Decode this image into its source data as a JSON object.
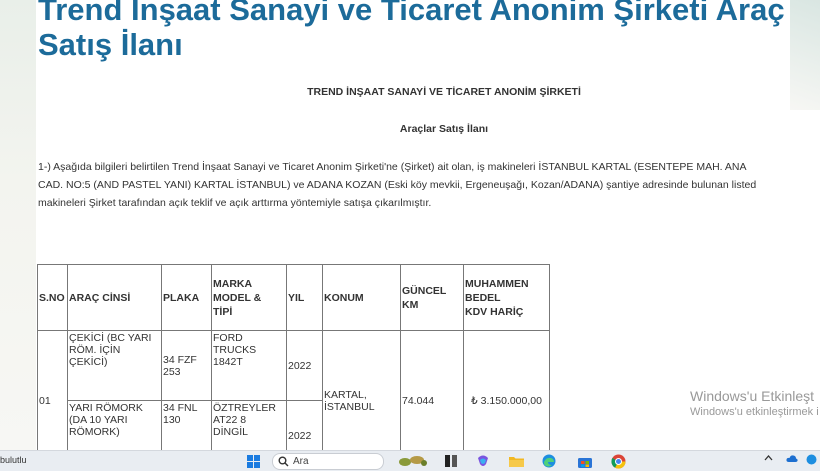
{
  "page": {
    "title_line1": "Trend İnşaat Sanayi ve Ticaret Anonim Şirketi Araç",
    "title_line2": "Satış İlanı",
    "company_heading": "TREND İNŞAAT SANAYİ VE TİCARET ANONİM ŞİRKETİ",
    "sub_heading": "Araçlar Satış İlanı",
    "paragraph_lines": [
      "1-) Aşağıda bilgileri belirtilen Trend İnşaat Sanayi ve Ticaret Anonim Şirketi'ne (Şirket) ait olan, iş makineleri İSTANBUL KARTAL (ESENTEPE MAH. ANA",
      "CAD. NO:5 (AND PASTEL YANI) KARTAL İSTANBUL) ve ADANA KOZAN (Eski köy mevkii, Ergeneuşağı, Kozan/ADANA) şantiye adresinde bulunan listed",
      "makineleri Şirket tarafından açık teklif ve açık arttırma yöntemiyle satışa çıkarılmıştır."
    ]
  },
  "table": {
    "headers": {
      "sno": "S.NO",
      "arac_cinsi": "ARAÇ CİNSİ",
      "plaka": "PLAKA",
      "marka_l1": "MARKA",
      "marka_l2": "MODEL &",
      "marka_l3": "TİPİ",
      "yil": "YIL",
      "konum": "KONUM",
      "guncel_l1": "GÜNCEL",
      "guncel_l2": "KM",
      "bedel_l1": "MUHAMMEN",
      "bedel_l2": "BEDEL",
      "bedel_l3": "KDV HARİÇ"
    },
    "row1": {
      "sno": "01",
      "konum_l1": "KARTAL,",
      "konum_l2": "İSTANBUL",
      "km": "74.044",
      "bedel": "₺ 3.150.000,00",
      "v1": {
        "cins_l1": "ÇEKİCİ (BC YARI",
        "cins_l2": "RÖM. İÇİN",
        "cins_l3": "ÇEKİCİ)",
        "plaka_l1": "34 FZF",
        "plaka_l2": "253",
        "marka_l1": "FORD",
        "marka_l2": "TRUCKS",
        "marka_l3": "1842T",
        "yil": "2022"
      },
      "v2": {
        "cins_l1": "YARI RÖMORK",
        "cins_l2": "(DA 10 YARI",
        "cins_l3": "RÖMORK)",
        "plaka_l1": "34 FNL",
        "plaka_l2": "130",
        "marka_l1": "ÖZTREYLER",
        "marka_l2": "AT22 8",
        "marka_l3": "DİNGİL",
        "yil": "2022"
      }
    }
  },
  "watermark": {
    "line1": "Windows'u Etkinleşt",
    "line2": "Windows'u etkinleştirmek i"
  },
  "taskbar": {
    "left_text": "bulutlu",
    "search_placeholder": "Ara"
  },
  "colors": {
    "title": "#1c6b9a",
    "border": "#777777"
  }
}
